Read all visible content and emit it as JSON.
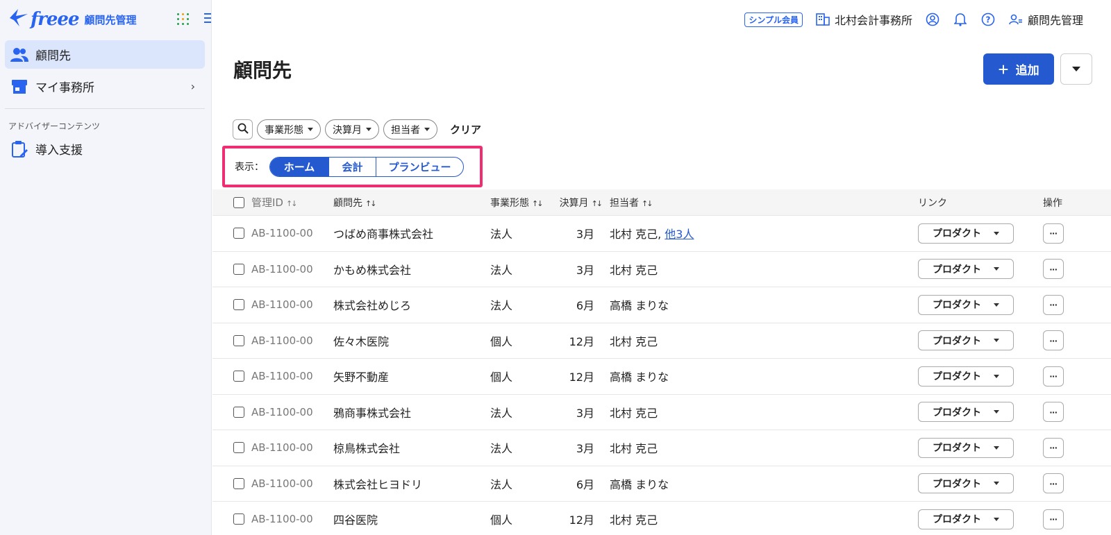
{
  "app": {
    "brand": "freee",
    "name": "顧問先管理"
  },
  "sidebar": {
    "items": [
      {
        "label": "顧問先",
        "icon": "users-icon",
        "active": true
      },
      {
        "label": "マイ事務所",
        "icon": "store-icon",
        "active": false
      }
    ],
    "section_label": "アドバイザーコンテンツ",
    "section_items": [
      {
        "label": "導入支援",
        "icon": "clipboard-edit-icon"
      }
    ]
  },
  "header": {
    "plan_badge": "シンプル会員",
    "office_name": "北村会計事務所",
    "user_label": "顧問先管理"
  },
  "main": {
    "title": "顧問先",
    "add_label": "追加",
    "filters": [
      "事業形態",
      "決算月",
      "担当者"
    ],
    "clear_label": "クリア",
    "view_label": "表示：",
    "view_options": [
      "ホーム",
      "会計",
      "プランビュー"
    ],
    "view_selected": "ホーム"
  },
  "table": {
    "columns": {
      "id": "管理ID",
      "name": "顧問先",
      "type": "事業形態",
      "month": "決算月",
      "staff": "担当者",
      "link": "リンク",
      "op": "操作"
    },
    "product_label": "プロダクト",
    "ops_label": "···",
    "rows": [
      {
        "id": "AB-1100-00",
        "name": "つばめ商事株式会社",
        "type": "法人",
        "month": "3月",
        "staff": "北村 克己,",
        "extra": "他3人"
      },
      {
        "id": "AB-1100-00",
        "name": "かもめ株式会社",
        "type": "法人",
        "month": "3月",
        "staff": "北村 克己",
        "extra": ""
      },
      {
        "id": "AB-1100-00",
        "name": "株式会社めじろ",
        "type": "法人",
        "month": "6月",
        "staff": "高橋 まりな",
        "extra": ""
      },
      {
        "id": "AB-1100-00",
        "name": "佐々木医院",
        "type": "個人",
        "month": "12月",
        "staff": "北村 克己",
        "extra": ""
      },
      {
        "id": "AB-1100-00",
        "name": "矢野不動産",
        "type": "個人",
        "month": "12月",
        "staff": "高橋 まりな",
        "extra": ""
      },
      {
        "id": "AB-1100-00",
        "name": "鴉商事株式会社",
        "type": "法人",
        "month": "3月",
        "staff": "北村 克己",
        "extra": ""
      },
      {
        "id": "AB-1100-00",
        "name": "椋鳥株式会社",
        "type": "法人",
        "month": "3月",
        "staff": "北村 克己",
        "extra": ""
      },
      {
        "id": "AB-1100-00",
        "name": "株式会社ヒヨドリ",
        "type": "法人",
        "month": "6月",
        "staff": "高橋 まりな",
        "extra": ""
      },
      {
        "id": "AB-1100-00",
        "name": "四谷医院",
        "type": "個人",
        "month": "12月",
        "staff": "北村 克己",
        "extra": ""
      }
    ]
  },
  "colors": {
    "primary": "#2459d0",
    "highlight": "#ef2d73",
    "sidebar_bg": "#f3f5fa",
    "active_bg": "#dbe6fd"
  }
}
